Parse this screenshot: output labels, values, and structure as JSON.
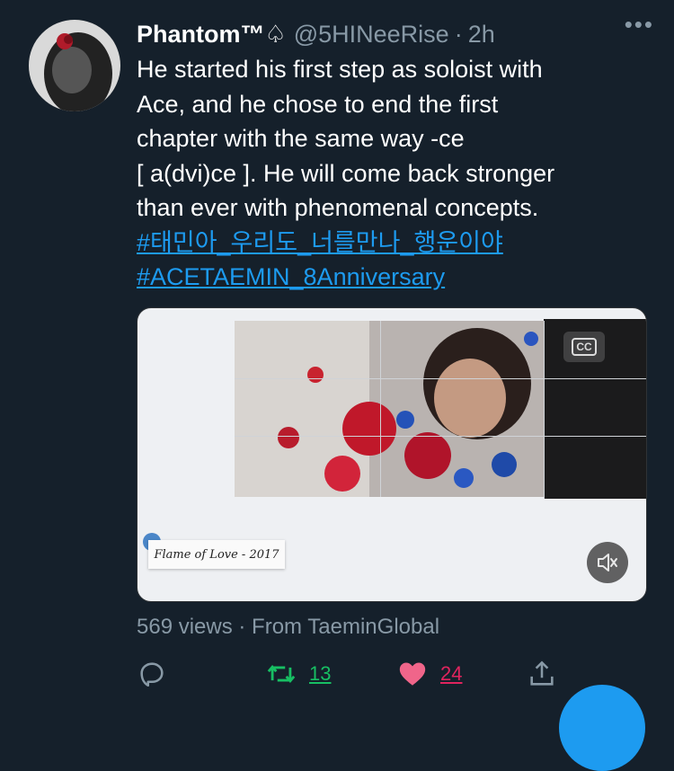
{
  "tweet": {
    "display_name": "Phantom™♤",
    "handle": "@5HINeeRise",
    "separator": "·",
    "time": "2h",
    "more_label": "•••",
    "text_lines": [
      "He started his first step as soloist with",
      "Ace, and he chose to end the first",
      "chapter with the same way -ce",
      "[ a(dvi)ce ]. He will come back stronger",
      "than ever with phenomenal concepts."
    ],
    "hashtags": [
      "#태민아_우리도_너를만나_행운이야",
      "#ACETAEMIN_8Anniversary"
    ]
  },
  "media": {
    "caption_card": "Flame of Love - 2017",
    "cc_label": "CC",
    "mute_icon": "speaker-muted-icon"
  },
  "meta": {
    "views_text": "569 views · From TaeminGlobal"
  },
  "actions": {
    "retweet_count": "13",
    "like_count": "24"
  },
  "colors": {
    "background": "#15202b",
    "link": "#1d9bf0",
    "retweet": "#17bf63",
    "like": "#e0245e",
    "muted_text": "#8899a6"
  }
}
